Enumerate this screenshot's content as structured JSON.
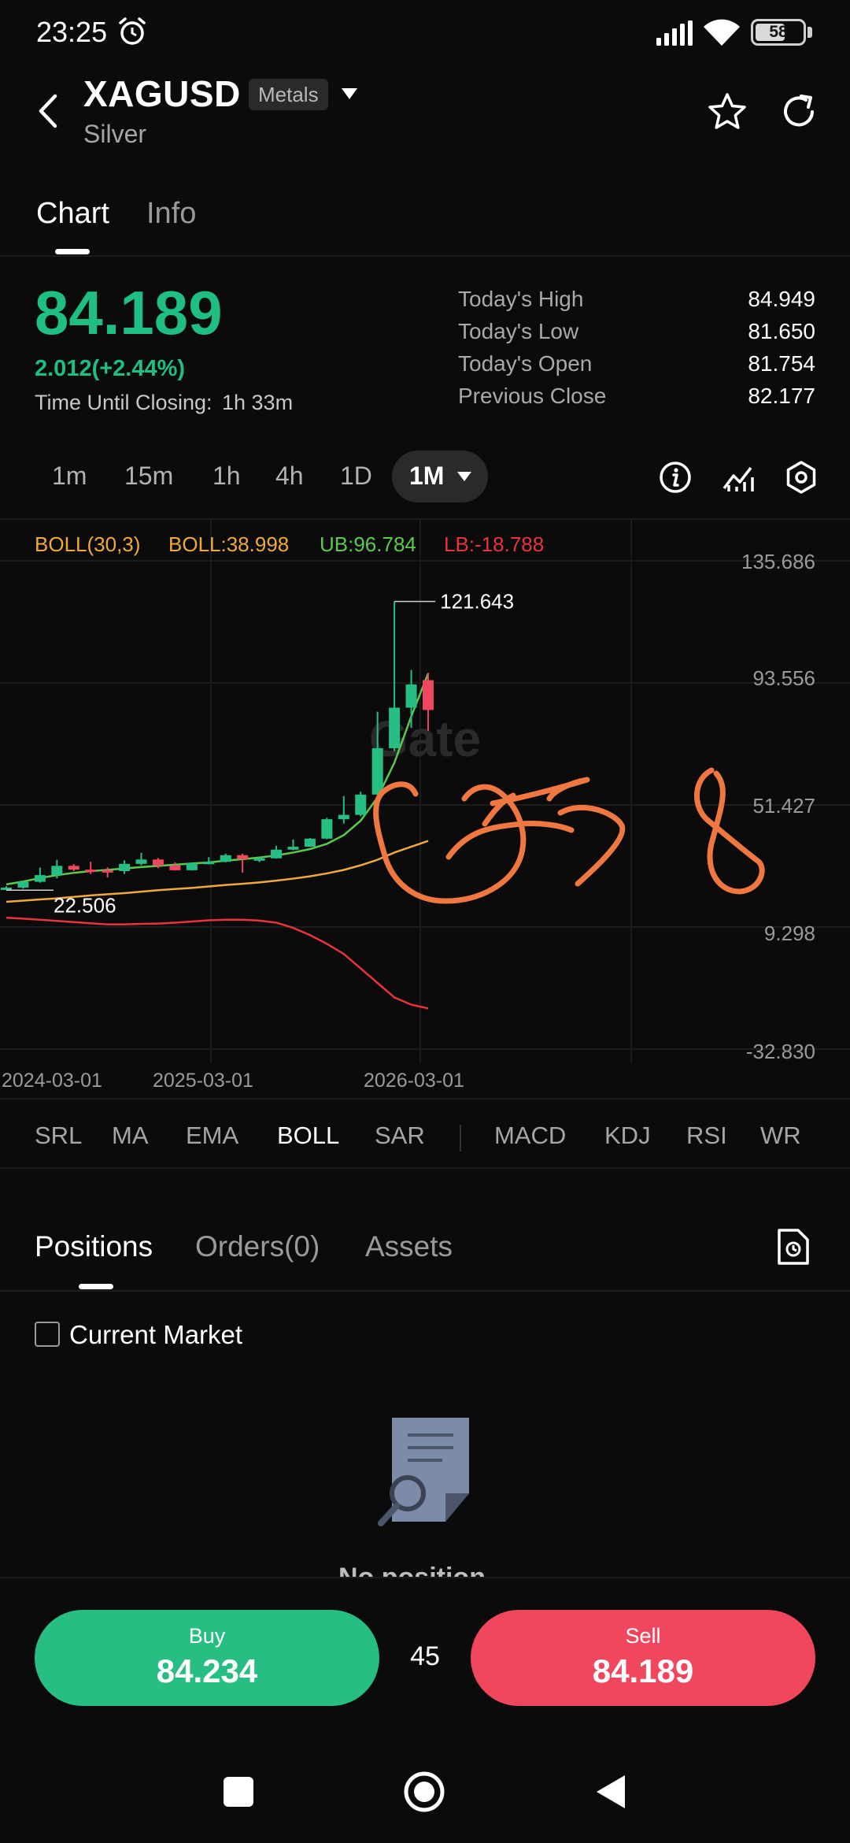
{
  "status_bar": {
    "time": "23:25",
    "battery": "58"
  },
  "header": {
    "symbol": "XAGUSD",
    "category": "Metals",
    "name": "Silver"
  },
  "tabs": [
    {
      "label": "Chart"
    },
    {
      "label": "Info"
    }
  ],
  "quote": {
    "price": "84.189",
    "change": "2.012(+2.44%)",
    "closing_label": "Time Until Closing:",
    "closing_value": "1h 33m",
    "stats": [
      {
        "label": "Today's High",
        "value": "84.949"
      },
      {
        "label": "Today's Low",
        "value": "81.650"
      },
      {
        "label": "Today's Open",
        "value": "81.754"
      },
      {
        "label": "Previous Close",
        "value": "82.177"
      }
    ]
  },
  "timeframes": {
    "items": [
      "1m",
      "15m",
      "1h",
      "4h",
      "1D"
    ],
    "active": "1M"
  },
  "chart": {
    "boll_name": "BOLL(30,3)",
    "boll_value": "BOLL:38.998",
    "ub": "UB:96.784",
    "lb": "LB:-18.788",
    "high_marker": "121.643",
    "low_marker": "22.506",
    "y_labels": [
      "135.686",
      "93.556",
      "51.427",
      "9.298",
      "-32.830"
    ],
    "x_labels": [
      "2024-03-01",
      "2025-03-01",
      "2026-03-01"
    ],
    "watermark": "Gate"
  },
  "chart_data": {
    "type": "candlestick",
    "ylim": [
      -32.83,
      135.686
    ],
    "y_ticks": [
      135.686,
      93.556,
      51.427,
      9.298,
      -32.83
    ],
    "x_ticks": [
      "2024-03-01",
      "2025-03-01",
      "2026-03-01"
    ],
    "candles": [
      {
        "date": "2024-02-01",
        "open": 22.6,
        "high": 23.4,
        "low": 22.0,
        "close": 22.9
      },
      {
        "date": "2024-03-01",
        "open": 22.9,
        "high": 25.3,
        "low": 22.5,
        "close": 24.9
      },
      {
        "date": "2024-04-01",
        "open": 24.9,
        "high": 29.8,
        "low": 24.6,
        "close": 27.2
      },
      {
        "date": "2024-05-01",
        "open": 27.2,
        "high": 32.5,
        "low": 26.1,
        "close": 30.4
      },
      {
        "date": "2024-06-01",
        "open": 30.4,
        "high": 31.0,
        "low": 28.6,
        "close": 29.1
      },
      {
        "date": "2024-07-01",
        "open": 29.1,
        "high": 31.8,
        "low": 27.6,
        "close": 28.9
      },
      {
        "date": "2024-08-01",
        "open": 28.9,
        "high": 29.9,
        "low": 26.4,
        "close": 28.6
      },
      {
        "date": "2024-09-01",
        "open": 28.6,
        "high": 32.3,
        "low": 27.6,
        "close": 31.1
      },
      {
        "date": "2024-10-01",
        "open": 31.1,
        "high": 34.9,
        "low": 30.6,
        "close": 32.6
      },
      {
        "date": "2024-11-01",
        "open": 32.6,
        "high": 33.1,
        "low": 29.6,
        "close": 30.5
      },
      {
        "date": "2024-12-01",
        "open": 30.5,
        "high": 31.6,
        "low": 28.8,
        "close": 28.9
      },
      {
        "date": "2025-01-01",
        "open": 28.9,
        "high": 31.6,
        "low": 28.8,
        "close": 31.3
      },
      {
        "date": "2025-02-01",
        "open": 31.3,
        "high": 33.4,
        "low": 30.9,
        "close": 31.8
      },
      {
        "date": "2025-03-01",
        "open": 31.8,
        "high": 34.6,
        "low": 31.6,
        "close": 34.1
      },
      {
        "date": "2025-04-01",
        "open": 34.1,
        "high": 34.6,
        "low": 28.0,
        "close": 32.7
      },
      {
        "date": "2025-05-01",
        "open": 32.7,
        "high": 33.6,
        "low": 31.7,
        "close": 33.0
      },
      {
        "date": "2025-06-01",
        "open": 33.0,
        "high": 37.3,
        "low": 32.9,
        "close": 36.0
      },
      {
        "date": "2025-07-01",
        "open": 36.0,
        "high": 39.5,
        "low": 35.8,
        "close": 37.0
      },
      {
        "date": "2025-08-01",
        "open": 37.0,
        "high": 40.0,
        "low": 36.9,
        "close": 39.8
      },
      {
        "date": "2025-09-01",
        "open": 39.8,
        "high": 47.0,
        "low": 39.6,
        "close": 46.5
      },
      {
        "date": "2025-10-01",
        "open": 46.5,
        "high": 54.5,
        "low": 45.0,
        "close": 48.0
      },
      {
        "date": "2025-11-01",
        "open": 48.0,
        "high": 56.0,
        "low": 47.5,
        "close": 55.0
      },
      {
        "date": "2025-12-01",
        "open": 55.0,
        "high": 83.6,
        "low": 54.8,
        "close": 71.0
      },
      {
        "date": "2026-01-01",
        "open": 71.0,
        "high": 121.643,
        "low": 70.0,
        "close": 85.0
      },
      {
        "date": "2026-02-01",
        "open": 85.0,
        "high": 98.0,
        "low": 78.0,
        "close": 93.0
      },
      {
        "date": "2026-03-01",
        "open": 94.5,
        "high": 97.0,
        "low": 77.0,
        "close": 84.189
      }
    ],
    "series": [
      {
        "name": "UB",
        "color": "#5cc94d",
        "values": [
          24.0,
          25.0,
          26.2,
          27.2,
          28.0,
          28.6,
          29.0,
          29.5,
          30.0,
          30.4,
          30.8,
          31.2,
          31.6,
          32.2,
          32.7,
          33.3,
          34.0,
          35.0,
          36.2,
          38.0,
          41.0,
          46.0,
          54.0,
          66.0,
          82.0,
          96.784
        ]
      },
      {
        "name": "BOLL",
        "color": "#f0a93c",
        "values": [
          18.0,
          18.4,
          18.8,
          19.2,
          19.7,
          20.2,
          20.6,
          21.0,
          21.5,
          22.0,
          22.4,
          22.8,
          23.3,
          23.8,
          24.2,
          24.7,
          25.3,
          26.0,
          26.8,
          27.8,
          29.0,
          30.6,
          32.5,
          35.0,
          37.0,
          38.998
        ]
      },
      {
        "name": "LB",
        "color": "#e8343c",
        "values": [
          12.5,
          12.2,
          11.8,
          11.4,
          11.0,
          10.6,
          10.2,
          10.2,
          10.4,
          10.5,
          10.8,
          11.2,
          11.6,
          11.8,
          11.8,
          11.5,
          10.8,
          9.0,
          6.5,
          3.5,
          0.0,
          -5.0,
          -10.0,
          -15.0,
          -17.5,
          -18.788
        ]
      }
    ]
  },
  "indicators": {
    "main": [
      "SRL",
      "MA",
      "EMA",
      "BOLL",
      "SAR"
    ],
    "sub": [
      "MACD",
      "KDJ",
      "RSI",
      "WR"
    ],
    "active": "BOLL"
  },
  "positions": {
    "tabs": [
      "Positions",
      "Orders(0)",
      "Assets"
    ],
    "filter_label": "Current Market",
    "empty_text": "No position"
  },
  "trade": {
    "buy_label": "Buy",
    "buy_price": "84.234",
    "spread": "45",
    "sell_label": "Sell",
    "sell_price": "84.189"
  },
  "colors": {
    "up": "#26be83",
    "down": "#f0475e",
    "background": "#0b0b0b",
    "annotation": "#f07840"
  }
}
